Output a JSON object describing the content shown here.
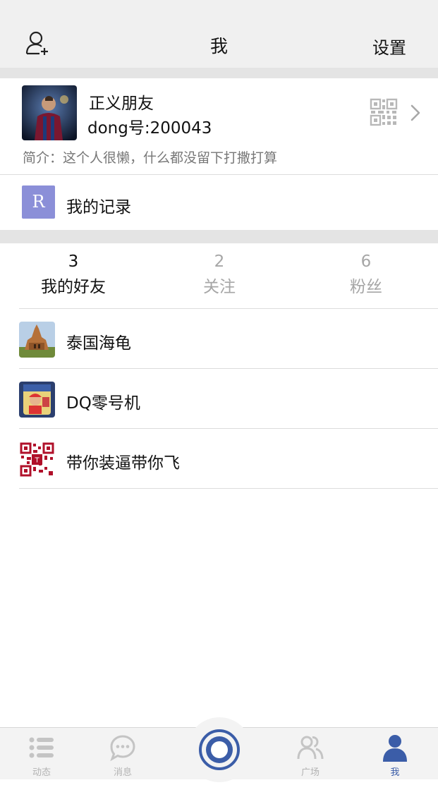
{
  "header": {
    "title": "我",
    "settings_label": "设置",
    "add_friend_icon": "add-user-icon"
  },
  "profile": {
    "name": "正义朋友",
    "dong_id": "dong号:200043",
    "bio": "简介：这个人很懒，什么都没留下打撒打算",
    "qr_icon": "qr-code-icon",
    "chevron_icon": "chevron-right-icon"
  },
  "records": {
    "badge_letter": "R",
    "label": "我的记录",
    "badge_color": "#8b8fd8"
  },
  "stats": [
    {
      "count": "3",
      "label": "我的好友",
      "active": true
    },
    {
      "count": "2",
      "label": "关注",
      "active": false
    },
    {
      "count": "6",
      "label": "粉丝",
      "active": false
    }
  ],
  "friends": [
    {
      "name": "泰国海龟"
    },
    {
      "name": "DQ零号机"
    },
    {
      "name": "带你装逼带你飞"
    }
  ],
  "tabbar": {
    "items": [
      {
        "label": "动态",
        "icon": "list-icon",
        "active": false
      },
      {
        "label": "消息",
        "icon": "chat-bubble-icon",
        "active": false
      },
      {
        "label": "广场",
        "icon": "people-icon",
        "active": false
      },
      {
        "label": "我",
        "icon": "person-icon",
        "active": true
      }
    ],
    "center_icon": "camera-shutter-icon",
    "accent_color": "#3b5da8"
  }
}
